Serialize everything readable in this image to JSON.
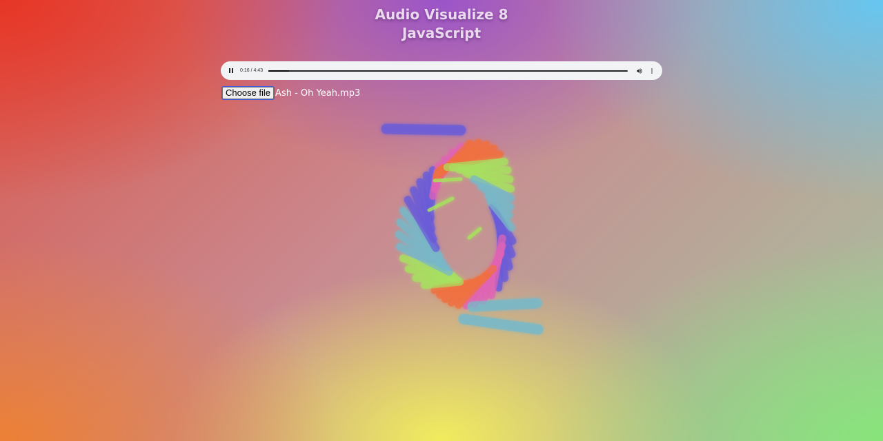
{
  "page": {
    "title_line1": "Audio Visualize 8",
    "title_line2": "JavaScript"
  },
  "player": {
    "time_display": "0:16 / 4:43",
    "progress_fraction": 0.0565,
    "state": "playing"
  },
  "file_input": {
    "button_label": "Choose file",
    "selected_file": "Ash - Oh Yeah.mp3"
  },
  "icons": {
    "play_state": "pause-icon",
    "volume": "volume-icon",
    "menu": "more-vert-icon"
  },
  "colors": {
    "bar_purple": "#6a5cd8",
    "bar_pink": "#e064b4",
    "bar_orange": "#f07040",
    "bar_green": "#a8e060",
    "bar_teal": "#78b8c8",
    "glow": "#f4c060"
  }
}
